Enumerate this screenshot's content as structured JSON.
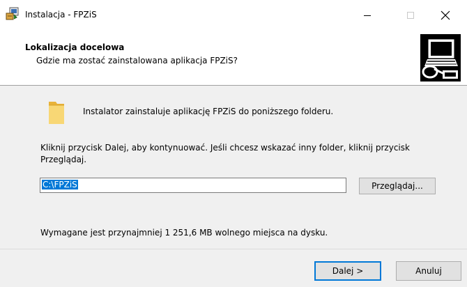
{
  "window": {
    "title": "Instalacja - FPZiS",
    "icon": "installer-icon",
    "controls": {
      "minimize_icon": "minimize-icon",
      "maximize_icon": "maximize-icon",
      "close_icon": "close-icon"
    }
  },
  "header": {
    "title": "Lokalizacja docelowa",
    "subtitle": "Gdzie ma zostać zainstalowana aplikacja FPZiS?",
    "image_icon": "computer-install-icon"
  },
  "main": {
    "folder_icon": "folder-icon",
    "info_text": "Instalator zainstaluje aplikację FPZiS do poniższego folderu.",
    "instruction_text": "Kliknij przycisk Dalej, aby kontynuować. Jeśli chcesz wskazać inny folder, kliknij przycisk Przeglądaj.",
    "path_value": "C:\\FPZiS",
    "browse_label": "Przeglądaj...",
    "space_text": "Wymagane jest przynajmniej 1 251,6 MB wolnego miejsca na dysku."
  },
  "footer": {
    "next_label": "Dalej >",
    "cancel_label": "Anuluj"
  },
  "colors": {
    "accent": "#0078d7",
    "content_bg": "#f0f0f0",
    "button_bg": "#e1e1e1"
  }
}
